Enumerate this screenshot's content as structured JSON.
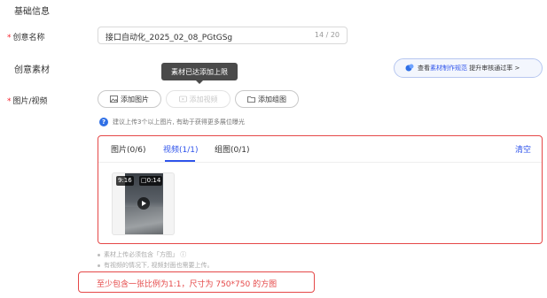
{
  "section_basic": "基础信息",
  "creative_name": {
    "label": "创意名称",
    "value": "接口自动化_2025_02_08_PGtGSg",
    "count": "14 / 20"
  },
  "section_material": "创意素材",
  "guide": {
    "prefix": "查看",
    "emphasis": "素材制作规范",
    "suffix": "提升审核通过率 >"
  },
  "tooltip": "素材已达添加上限",
  "media": {
    "label": "图片/视频",
    "buttons": {
      "add_image": "添加图片",
      "add_video": "添加视频",
      "add_group": "添加组图"
    },
    "hint": "建议上传3个以上图片, 有助于获得更多展位曝光",
    "tabs": [
      "图片(0/6)",
      "视频(1/1)",
      "组图(0/1)"
    ],
    "active_tab": "视频(1/1)",
    "clear": "清空",
    "video": {
      "ratio": "9:16",
      "duration": "0:14"
    },
    "notes": [
      "素材上传必须包含「方图」 ⓘ",
      "有视频的情况下, 视频封面也需要上传。"
    ],
    "error": "至少包含一张比例为1:1，尺寸为 750*750 的方图"
  },
  "colors": {
    "accent": "#2f54eb",
    "error": "#e54848",
    "required": "#f5222d"
  }
}
